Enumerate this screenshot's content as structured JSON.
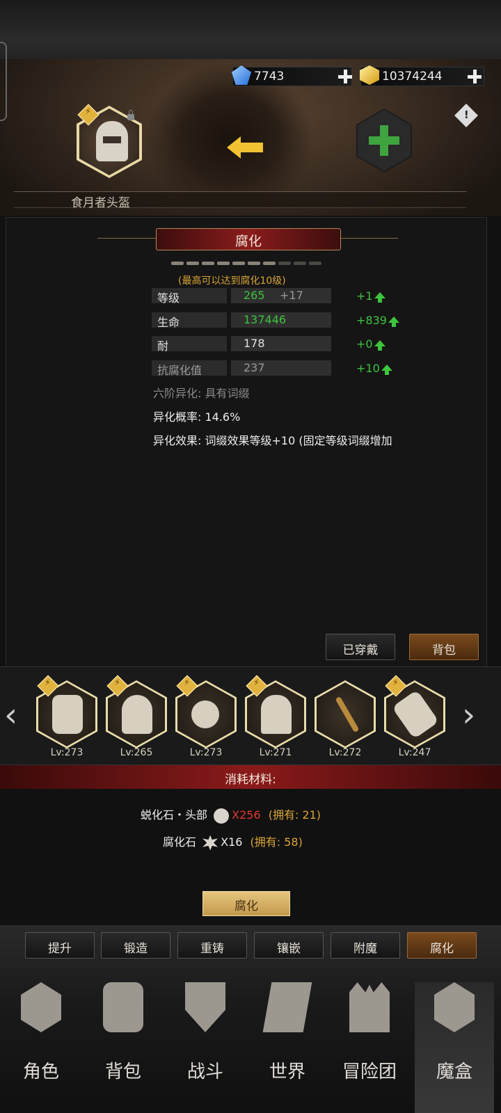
{
  "currency": {
    "gems": "7743",
    "gold": "10374244"
  },
  "item": {
    "name": "食月者头盔",
    "current_badge": "⚡"
  },
  "panel": {
    "title": "腐化",
    "progress": {
      "filled": 7,
      "total": 10
    },
    "max_note": "(最高可以达到腐化10级)",
    "stats": [
      {
        "label": "等级",
        "value": "265",
        "bonus": "+17",
        "increase": "+1"
      },
      {
        "label": "生命",
        "value": "137446",
        "bonus": "",
        "increase": "+839"
      },
      {
        "label": "耐",
        "value": "178",
        "bonus": "",
        "increase": "+0"
      },
      {
        "label": "抗腐化值",
        "value": "237",
        "bonus": "",
        "increase": "+10"
      }
    ],
    "mutation": "六阶异化:  具有词缀",
    "mutation_rate": "异化概率:  14.6%",
    "mutation_effect": "异化效果:  词缀效果等级+10 (固定等级词缀增加",
    "equipped_label": "已穿戴",
    "bag_label": "背包"
  },
  "equipment": [
    {
      "level": "Lv:273"
    },
    {
      "level": "Lv:265"
    },
    {
      "level": "Lv:273"
    },
    {
      "level": "Lv:271"
    },
    {
      "level": "Lv:272"
    },
    {
      "level": "Lv:247"
    }
  ],
  "consumables": {
    "title": "消耗材料:",
    "items": [
      {
        "name": "蜕化石・头部",
        "qty": "X256",
        "owned": "(拥有: 21)",
        "insufficient": true
      },
      {
        "name": "腐化石",
        "qty": "X16",
        "owned": "(拥有: 58)",
        "insufficient": false
      }
    ]
  },
  "action_button": "腐化",
  "tabs": [
    "提升",
    "锻造",
    "重铸",
    "镶嵌",
    "附魔",
    "腐化"
  ],
  "active_tab": "腐化",
  "nav": [
    "角色",
    "背包",
    "战斗",
    "世界",
    "冒险团",
    "魔盒"
  ],
  "active_nav": "魔盒",
  "colors": {
    "accent_gold": "#d9a536",
    "increase_green": "#3dc43d",
    "warn_red": "#e03a2e",
    "title_red": "#8b1c1c"
  }
}
